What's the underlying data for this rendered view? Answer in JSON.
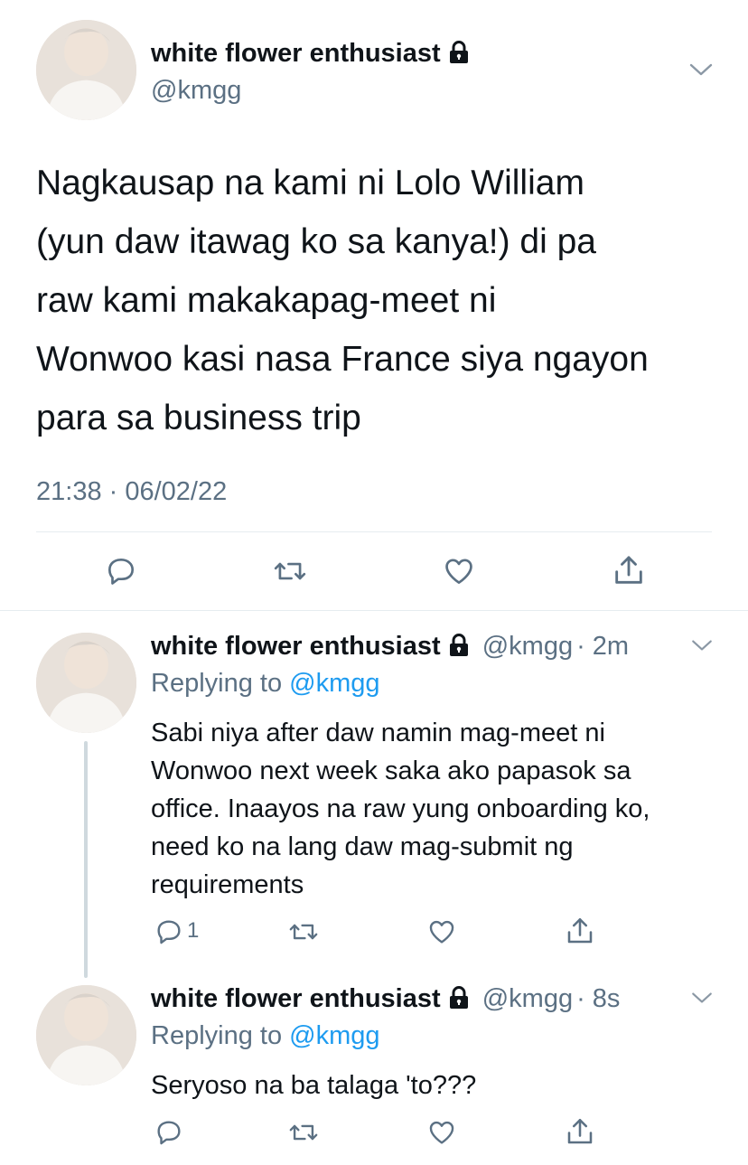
{
  "main_tweet": {
    "display_name": "white flower enthusiast",
    "handle": "@kmgg",
    "text_lines": [
      "Nagkausap na kami ni Lolo William",
      "(yun daw itawag ko sa kanya!) di pa",
      "raw kami makakapag-meet ni",
      "Wonwoo kasi nasa France siya ngayon",
      "para sa business trip"
    ],
    "timestamp": "21:38 · 06/02/22",
    "icons": [
      "reply-icon",
      "retweet-icon",
      "like-icon",
      "share-icon"
    ]
  },
  "replies": [
    {
      "display_name": "white flower enthusiast",
      "handle": "@kmgg",
      "time": "· 2m",
      "replying_prefix": "Replying to",
      "replying_to": "@kmgg",
      "text_lines": [
        "Sabi niya after daw namin mag-meet ni",
        "Wonwoo next week saka ako papasok sa",
        "office. Inaayos na raw yung onboarding ko,",
        "need ko na lang daw mag-submit ng",
        "requirements"
      ],
      "reply_count": "1"
    },
    {
      "display_name": "white flower enthusiast",
      "handle": "@kmgg",
      "time": "· 8s",
      "replying_prefix": "Replying to",
      "replying_to": "@kmgg",
      "text_lines": [
        "Seryoso na ba talaga 'to???"
      ],
      "reply_count": ""
    }
  ],
  "colors": {
    "text": "#0f1419",
    "muted": "#5b7083",
    "link": "#1d9bf0",
    "divider": "#e6ecf0"
  }
}
